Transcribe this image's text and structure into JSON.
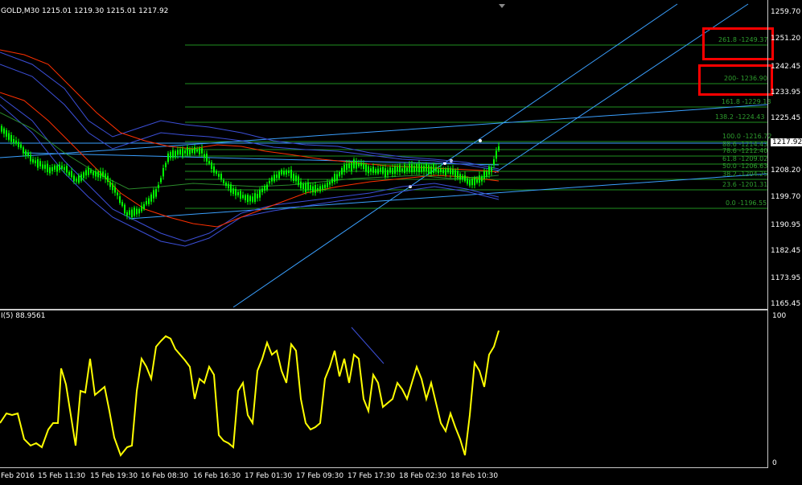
{
  "header": {
    "symbol_line": "GOLD,M30  1215.01  1219.30  1215.01  1217.92"
  },
  "price_axis": {
    "labels": [
      "1259.70",
      "1251.20",
      "1242.45",
      "1233.95",
      "1225.45",
      "1217.92",
      "1208.20",
      "1199.70",
      "1190.95",
      "1182.45",
      "1173.95",
      "1165.45"
    ],
    "current_price": "1217.92"
  },
  "fibonacci": {
    "levels": [
      {
        "label": "261.8 -1249.37"
      },
      {
        "label": "200- 1236.90"
      },
      {
        "label": "161.8 -1229.18"
      },
      {
        "label": "138.2 -1224.43"
      },
      {
        "label": "100.0 -1216.72"
      },
      {
        "label": "88.6 -1214.43"
      },
      {
        "label": "78.6 -1212.40"
      },
      {
        "label": "61.8 -1209.02"
      },
      {
        "label": "50.0 -1206.63"
      },
      {
        "label": "38.2 -1204.25"
      },
      {
        "label": "23.6 -1201.31"
      },
      {
        "label": "0.0 -1196.55"
      }
    ],
    "color": "#1f8f1f"
  },
  "indicator": {
    "label": "I(5) 88.9561",
    "axis_max": "100",
    "axis_min": "0",
    "line_color": "#ffff00"
  },
  "time_axis": {
    "labels": [
      "Feb 2016",
      "15 Feb 11:30",
      "15 Feb 19:30",
      "16 Feb 08:30",
      "16 Feb 16:30",
      "17 Feb 01:30",
      "17 Feb 09:30",
      "17 Feb 17:30",
      "18 Feb 02:30",
      "18 Feb 10:30"
    ]
  },
  "colors": {
    "background": "#000000",
    "candle": "#00ff00",
    "bollinger": "#3c4fd8",
    "moving_average": "#ff3000",
    "trendline": "#3aa0ff",
    "highlight_box": "#ff0000"
  }
}
